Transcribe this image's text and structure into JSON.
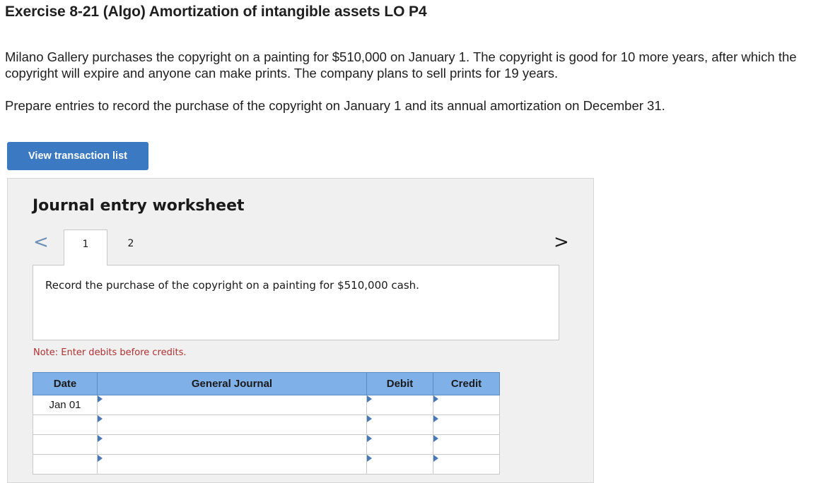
{
  "page": {
    "title": "Exercise 8-21 (Algo) Amortization of intangible assets LO P4",
    "paragraph1": "Milano Gallery purchases the copyright on a painting for $510,000 on January 1. The copyright is good for 10 more years, after which the copyright will expire and anyone can make prints. The company plans to sell prints for 19 years.",
    "paragraph2": "Prepare entries to record the purchase of the copyright on January 1 and its annual amortization on December 31.",
    "view_button": "View transaction list"
  },
  "worksheet": {
    "title": "Journal entry worksheet",
    "nav_prev": "<",
    "nav_next": ">",
    "tabs": [
      {
        "label": "1",
        "active": true
      },
      {
        "label": "2",
        "active": false
      }
    ],
    "instruction": "Record the purchase of the copyright on a painting for $510,000 cash.",
    "note": "Note: Enter debits before credits.",
    "table": {
      "headers": [
        "Date",
        "General Journal",
        "Debit",
        "Credit"
      ],
      "rows": [
        {
          "date": "Jan 01",
          "general_journal": "",
          "debit": "",
          "credit": ""
        },
        {
          "date": "",
          "general_journal": "",
          "debit": "",
          "credit": ""
        },
        {
          "date": "",
          "general_journal": "",
          "debit": "",
          "credit": ""
        },
        {
          "date": "",
          "general_journal": "",
          "debit": "",
          "credit": ""
        }
      ]
    }
  },
  "colors": {
    "button_bg": "#3b79c3",
    "table_header_bg": "#7fb1e8",
    "input_border": "#4a78b5",
    "note_text": "#b03030"
  }
}
